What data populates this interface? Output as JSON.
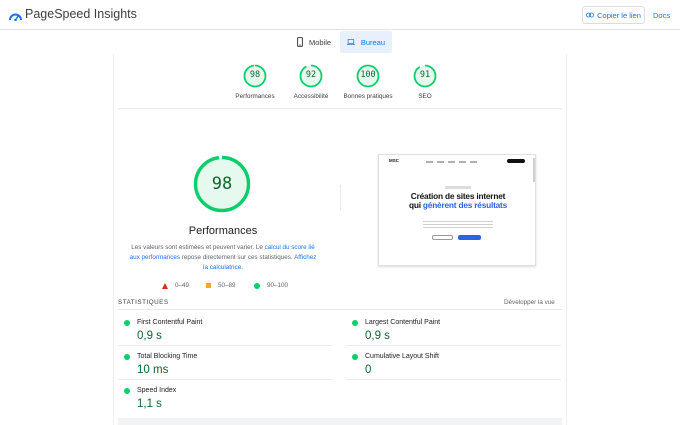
{
  "header": {
    "brand": "PageSpeed Insights",
    "copy_link": "Copier le lien",
    "docs": "Docs"
  },
  "tabs": [
    {
      "label": "Mobile",
      "icon": "phone-icon",
      "active": false
    },
    {
      "label": "Bureau",
      "icon": "laptop-icon",
      "active": true
    }
  ],
  "categories": [
    {
      "label": "Performances",
      "score": "98",
      "fraction": 0.98
    },
    {
      "label": "Accessibilité",
      "score": "92",
      "fraction": 0.92
    },
    {
      "label": "Bonnes pratiques",
      "score": "100",
      "fraction": 1.0
    },
    {
      "label": "SEO",
      "score": "91",
      "fraction": 0.91
    }
  ],
  "performance": {
    "score": "98",
    "fraction": 0.98,
    "title": "Performances",
    "desc_1": "Les valeurs sont estimées et peuvent varier. Le ",
    "desc_link_1": "calcul du score lié aux performances",
    "desc_2": " repose directement sur ces statistiques. ",
    "desc_link_2": "Affichez la calculatrice",
    "desc_3": "."
  },
  "legend": {
    "fail": "0–49",
    "average": "50–89",
    "pass": "90–100"
  },
  "preview": {
    "logo": "MSC",
    "headline_1": "Création de sites internet",
    "headline_2": "qui ",
    "headline_accent": "génèrent des résultats"
  },
  "stats": {
    "title": "STATISTIQUES",
    "expand": "Développer la vue",
    "metrics": [
      {
        "name": "First Contentful Paint",
        "value": "0,9 s"
      },
      {
        "name": "Largest Contentful Paint",
        "value": "0,9 s"
      },
      {
        "name": "Total Blocking Time",
        "value": "10 ms"
      },
      {
        "name": "Cumulative Layout Shift",
        "value": "0"
      },
      {
        "name": "Speed Index",
        "value": "1,1 s"
      }
    ]
  },
  "colors": {
    "pass": "#0cce6b",
    "pass_text": "#0d652d",
    "pass_bg": "#e6f9ef",
    "accent": "#1a73e8",
    "fail": "#e02d1b",
    "average": "#f9a825"
  }
}
